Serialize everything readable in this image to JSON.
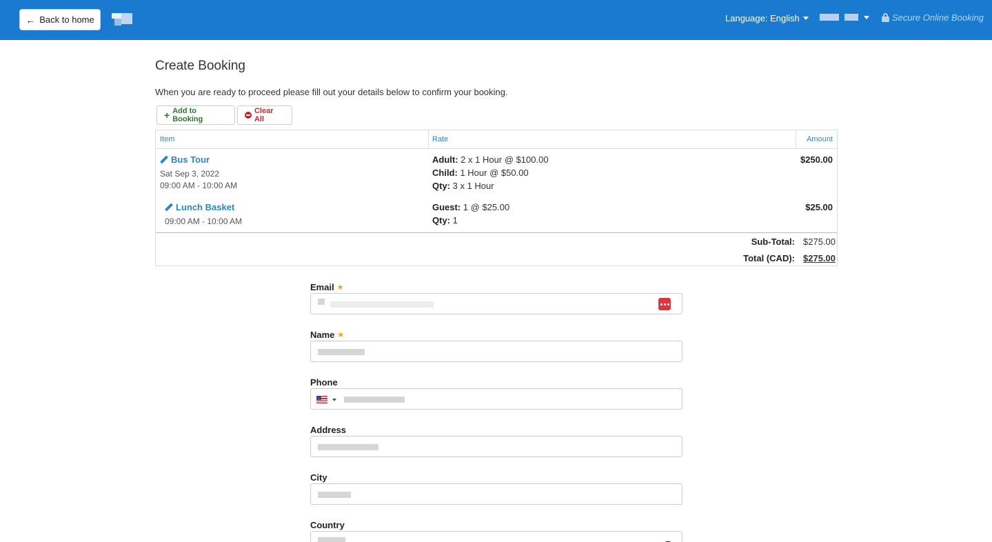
{
  "header": {
    "back_label": "Back to home",
    "language_label": "Language: English",
    "secure_label": "Secure Online Booking"
  },
  "page": {
    "title": "Create Booking",
    "intro": "When you are ready to proceed please fill out your details below to confirm your booking."
  },
  "actions": {
    "add_label": "Add to Booking",
    "clear_label": "Clear All"
  },
  "table": {
    "headers": {
      "item": "Item",
      "rate": "Rate",
      "amount": "Amount"
    },
    "rows": [
      {
        "name": "Bus Tour",
        "date": "Sat Sep 3, 2022",
        "time": "09:00 AM - 10:00 AM",
        "rates": [
          {
            "label": "Adult:",
            "value": "2 x 1 Hour @ $100.00"
          },
          {
            "label": "Child:",
            "value": "1 Hour @ $50.00"
          },
          {
            "label": "Qty:",
            "value": "3 x 1 Hour"
          }
        ],
        "amount": "$250.00"
      },
      {
        "name": "Lunch Basket",
        "time": "09:00 AM - 10:00 AM",
        "rates": [
          {
            "label": "Guest:",
            "value": "1 @ $25.00"
          },
          {
            "label": "Qty:",
            "value": "1"
          }
        ],
        "amount": "$25.00"
      }
    ],
    "subtotal_label": "Sub-Total:",
    "subtotal_value": "$275.00",
    "total_label": "Total (CAD):",
    "total_value": "$275.00"
  },
  "form": {
    "email_label": "Email",
    "name_label": "Name",
    "phone_label": "Phone",
    "address_label": "Address",
    "city_label": "City",
    "country_label": "Country",
    "required_icon": "star-icon",
    "phone_flag_icon": "us-flag-icon",
    "password_manager_icon": "password-manager-icon"
  }
}
